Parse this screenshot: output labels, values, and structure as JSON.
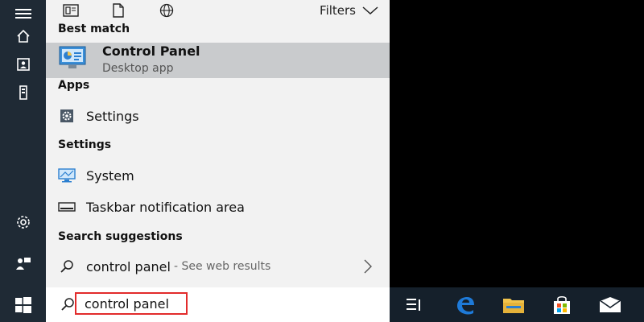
{
  "rail": {
    "items": [
      {
        "name": "hamburger-menu-icon"
      },
      {
        "name": "home-icon"
      },
      {
        "name": "notebook-icon"
      },
      {
        "name": "device-icon"
      },
      {
        "name": "settings-gear-icon"
      },
      {
        "name": "feedback-icon"
      }
    ]
  },
  "topbar": {
    "filters_label": "Filters"
  },
  "results": {
    "best_match_heading": "Best match",
    "best_match": {
      "title": "Control Panel",
      "subtitle": "Desktop app"
    },
    "apps_heading": "Apps",
    "apps": [
      {
        "label": "Settings"
      }
    ],
    "settings_heading": "Settings",
    "settings": [
      {
        "label": "System"
      },
      {
        "label": "Taskbar notification area"
      }
    ],
    "suggestions_heading": "Search suggestions",
    "suggestion": {
      "label": "control panel",
      "hint": "- See web results"
    }
  },
  "search": {
    "value": "control panel"
  },
  "colors": {
    "rail_bg": "#1f2a35",
    "panel_bg": "#f2f2f2",
    "highlight_bg": "#c9cbcd",
    "search_border": "#e22b2b",
    "taskbar_bg": "#15202b",
    "edge_blue": "#1e7ad8",
    "folder_yellow": "#f2c44c"
  }
}
